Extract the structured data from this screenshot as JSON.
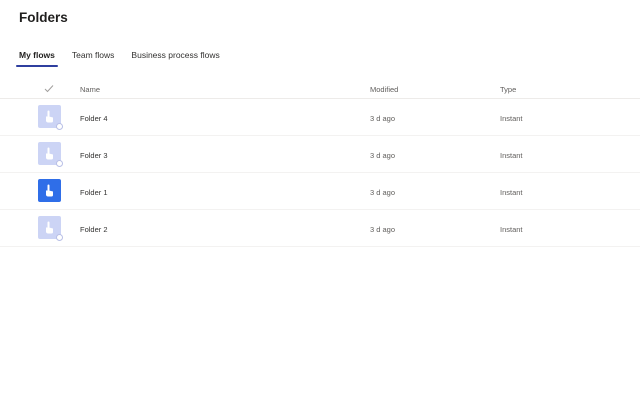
{
  "page": {
    "title": "Folders"
  },
  "tabs": [
    {
      "label": "My flows",
      "active": true
    },
    {
      "label": "Team flows",
      "active": false
    },
    {
      "label": "Business process flows",
      "active": false
    }
  ],
  "table": {
    "headers": {
      "select": "check-icon",
      "name": "Name",
      "modified": "Modified",
      "type": "Type"
    },
    "rows": [
      {
        "name": "Folder 4",
        "modified": "3 d ago",
        "type": "Instant",
        "icon": "touch-icon",
        "state": "faded"
      },
      {
        "name": "Folder 3",
        "modified": "3 d ago",
        "type": "Instant",
        "icon": "touch-icon",
        "state": "faded"
      },
      {
        "name": "Folder 1",
        "modified": "3 d ago",
        "type": "Instant",
        "icon": "touch-icon",
        "state": "solid"
      },
      {
        "name": "Folder 2",
        "modified": "3 d ago",
        "type": "Instant",
        "icon": "touch-icon",
        "state": "faded"
      }
    ]
  },
  "colors": {
    "accent": "#2f3f9f",
    "tile_solid": "#2f6ee8",
    "tile_faded": "#ccd4f5"
  }
}
